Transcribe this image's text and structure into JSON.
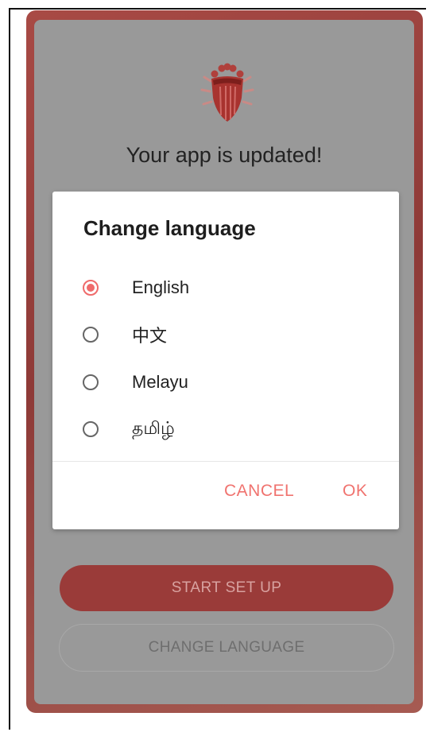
{
  "screen": {
    "headline": "Your app is updated!",
    "start_button": "START SET UP",
    "change_language_button": "CHANGE LANGUAGE",
    "logo_icon": "shield-crown-icon"
  },
  "dialog": {
    "title": "Change language",
    "selected": "English",
    "options": [
      {
        "label": "English",
        "checked": true
      },
      {
        "label": "中文",
        "checked": false
      },
      {
        "label": "Melayu",
        "checked": false
      },
      {
        "label": "தமிழ்",
        "checked": false
      }
    ],
    "cancel": "CANCEL",
    "ok": "OK"
  },
  "colors": {
    "accent": "#ef6b6b",
    "primary": "#9a3b39",
    "overlay": "#999999"
  }
}
